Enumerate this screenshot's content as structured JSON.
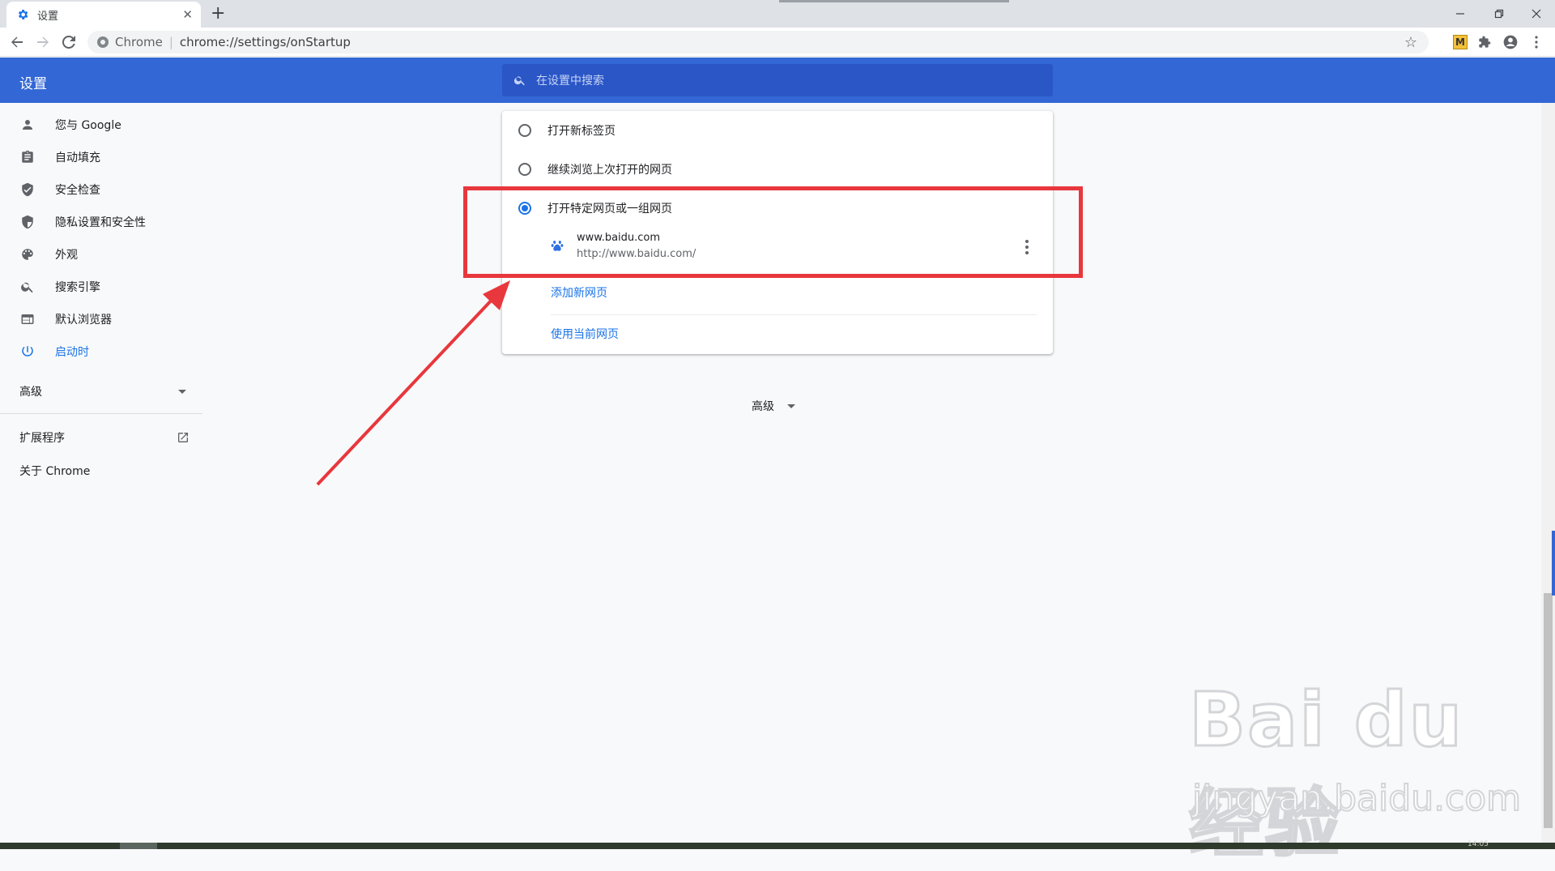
{
  "browser": {
    "tab_title": "设置",
    "tab_close": "✕",
    "new_tab": "+",
    "omnibox_site": "Chrome",
    "omnibox_sep": "|",
    "omnibox_url": "chrome://settings/onStartup",
    "extension_m_label": "M"
  },
  "settings": {
    "title": "设置",
    "search_placeholder": "在设置中搜索"
  },
  "sidebar": {
    "items": [
      {
        "label": "您与 Google",
        "icon": "person-icon"
      },
      {
        "label": "自动填充",
        "icon": "clipboard-icon"
      },
      {
        "label": "安全检查",
        "icon": "shield-check-icon"
      },
      {
        "label": "隐私设置和安全性",
        "icon": "shield-half-icon"
      },
      {
        "label": "外观",
        "icon": "palette-icon"
      },
      {
        "label": "搜索引擎",
        "icon": "search-icon"
      },
      {
        "label": "默认浏览器",
        "icon": "browser-window-icon"
      },
      {
        "label": "启动时",
        "icon": "power-icon",
        "active": true
      }
    ],
    "advanced": "高级",
    "extensions": "扩展程序",
    "about": "关于 Chrome"
  },
  "startup": {
    "options": [
      {
        "label": "打开新标签页",
        "checked": false
      },
      {
        "label": "继续浏览上次打开的网页",
        "checked": false
      },
      {
        "label": "打开特定网页或一组网页",
        "checked": true
      }
    ],
    "page": {
      "name": "www.baidu.com",
      "url": "http://www.baidu.com/"
    },
    "add_page": "添加新网页",
    "use_current": "使用当前网页"
  },
  "main": {
    "advanced": "高级"
  },
  "taskbar": {
    "clock": "14:05"
  },
  "watermark": {
    "logo": "Bai du 经验",
    "sub": "jingyan.baidu.com"
  },
  "colors": {
    "accent": "#1a73e8",
    "header": "#3367d6",
    "annotation": "#e8373d"
  }
}
